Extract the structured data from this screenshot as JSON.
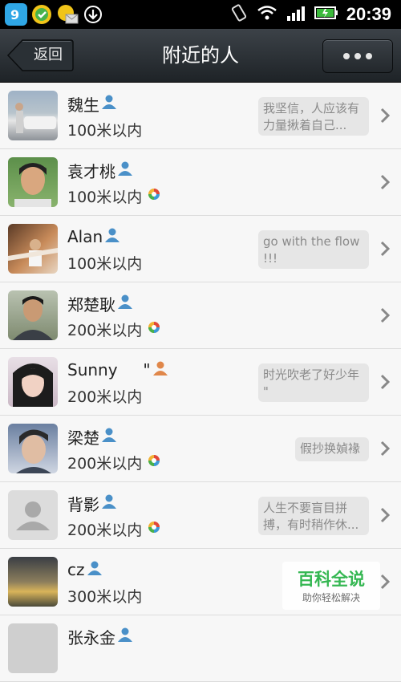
{
  "status_bar": {
    "time": "20:39"
  },
  "header": {
    "back_label": "返回",
    "title": "附近的人"
  },
  "people": [
    {
      "name": "魏生",
      "distance": "100米以内",
      "signature": "我坚信，人应该有力量揪着自己...",
      "has_circle_icon": false,
      "gender": "male"
    },
    {
      "name": "袁才桃",
      "distance": "100米以内",
      "signature": "",
      "has_circle_icon": true,
      "gender": "male"
    },
    {
      "name": "Alan",
      "distance": "100米以内",
      "signature": "go with the flow !!!",
      "has_circle_icon": false,
      "gender": "male"
    },
    {
      "name": "郑楚耿",
      "distance": "200米以内",
      "signature": "",
      "has_circle_icon": true,
      "gender": "male"
    },
    {
      "name": "Sunny     \"",
      "distance": "200米以内",
      "signature": "时光吹老了好少年      \"",
      "has_circle_icon": false,
      "gender": "female"
    },
    {
      "name": "梁楚",
      "distance": "200米以内",
      "signature": "假抄换媜褖",
      "has_circle_icon": true,
      "gender": "male"
    },
    {
      "name": "背影",
      "distance": "200米以内",
      "signature": "人生不要盲目拼搏，有时稍作休...",
      "has_circle_icon": true,
      "gender": "male"
    },
    {
      "name": "cz",
      "distance": "300米以内",
      "signature": "",
      "has_circle_icon": false,
      "gender": "male"
    },
    {
      "name": "张永金",
      "distance": "",
      "signature": "",
      "has_circle_icon": false,
      "gender": "male"
    }
  ],
  "watermark": {
    "title": "百科全说",
    "subtitle": "助你轻松解决"
  },
  "colors": {
    "titlebar": "#2a2f34",
    "row_bg": "#f7f7f7",
    "sign_bg": "#e6e6e6",
    "user_icon_male": "#4a90c8",
    "user_icon_female": "#e0874a"
  }
}
